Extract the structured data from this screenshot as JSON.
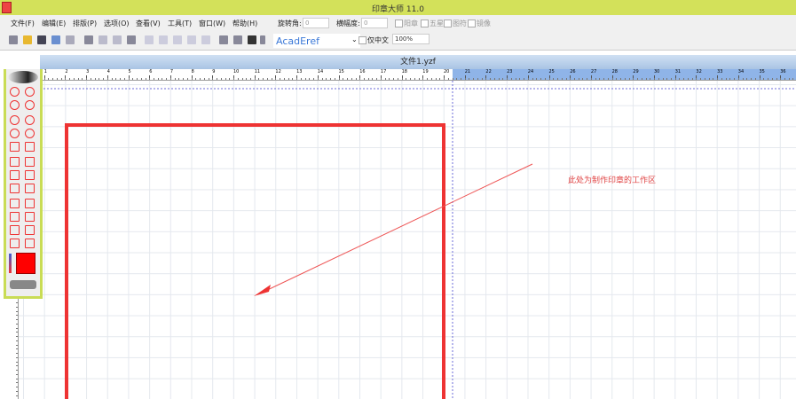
{
  "title": "印章大师 11.0",
  "menu": [
    "文件(F)",
    "编辑(E)",
    "排版(P)",
    "选项(O)",
    "查看(V)",
    "工具(T)",
    "窗口(W)",
    "帮助(H)"
  ],
  "rotate_label": "旋转角:",
  "rotate_value": "0",
  "scale_label": "横幅度:",
  "scale_value": "0",
  "checks": [
    "阳章",
    "五星",
    "图符",
    "镜像"
  ],
  "font_value": "AcadEref",
  "only_chinese": "仅中文",
  "zoom_value": "100%",
  "doc_title": "文件1.yzf",
  "annotation": "此处为制作印章的工作区",
  "colors": {
    "accent": "#d3e15a",
    "stamp": "#ee3333"
  }
}
